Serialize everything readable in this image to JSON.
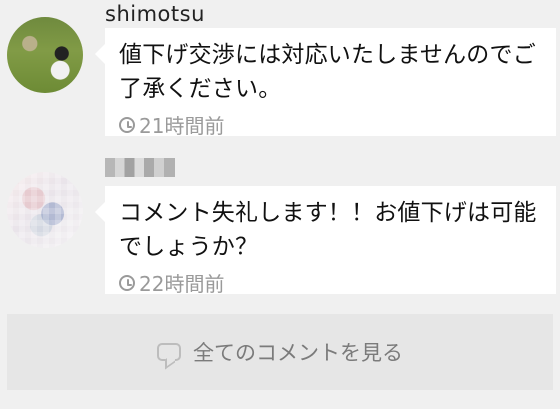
{
  "comments": [
    {
      "username": "shimotsu",
      "text": "値下げ交渉には対応いたしませんのでご了承ください。",
      "time": "21時間前"
    },
    {
      "username": "",
      "text": "コメント失礼します！！お値下げは可能でしょうか？",
      "time": "22時間前"
    }
  ],
  "actions": {
    "view_all_comments": "全てのコメントを見る"
  },
  "icons": {
    "time": "clock-icon",
    "comment": "speech-bubble-icon"
  }
}
